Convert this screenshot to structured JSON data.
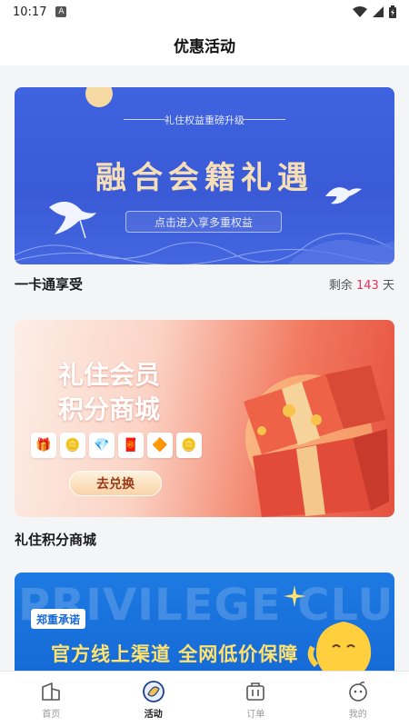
{
  "statusbar": {
    "time": "10:17",
    "notif_glyph": "A"
  },
  "header": {
    "title": "优惠活动"
  },
  "banners": [
    {
      "subtitle": "礼住权益重磅升级",
      "headline": "融合会籍礼遇",
      "button": "点击进入享多重权益",
      "caption": "一卡通享受",
      "remain_prefix": "剩余",
      "remain_days": "143",
      "remain_suffix": "天"
    },
    {
      "title_line1": "礼住会员",
      "title_line2": "积分商城",
      "button": "去兑换",
      "caption": "礼住积分商城"
    },
    {
      "bg_text": "PRIVILEGE CLUB",
      "tag": "郑重承诺",
      "headline": "官方线上渠道  全网低价保障"
    }
  ],
  "tabs": [
    {
      "label": "首页",
      "icon": "home-icon",
      "active": false
    },
    {
      "label": "活动",
      "icon": "activity-icon",
      "active": true
    },
    {
      "label": "订单",
      "icon": "order-icon",
      "active": false
    },
    {
      "label": "我的",
      "icon": "profile-icon",
      "active": false
    }
  ],
  "colors": {
    "accent": "#1b1b1b",
    "remain_num": "#e5305a",
    "banner1": "#3f63df",
    "banner3": "#1569d6"
  }
}
